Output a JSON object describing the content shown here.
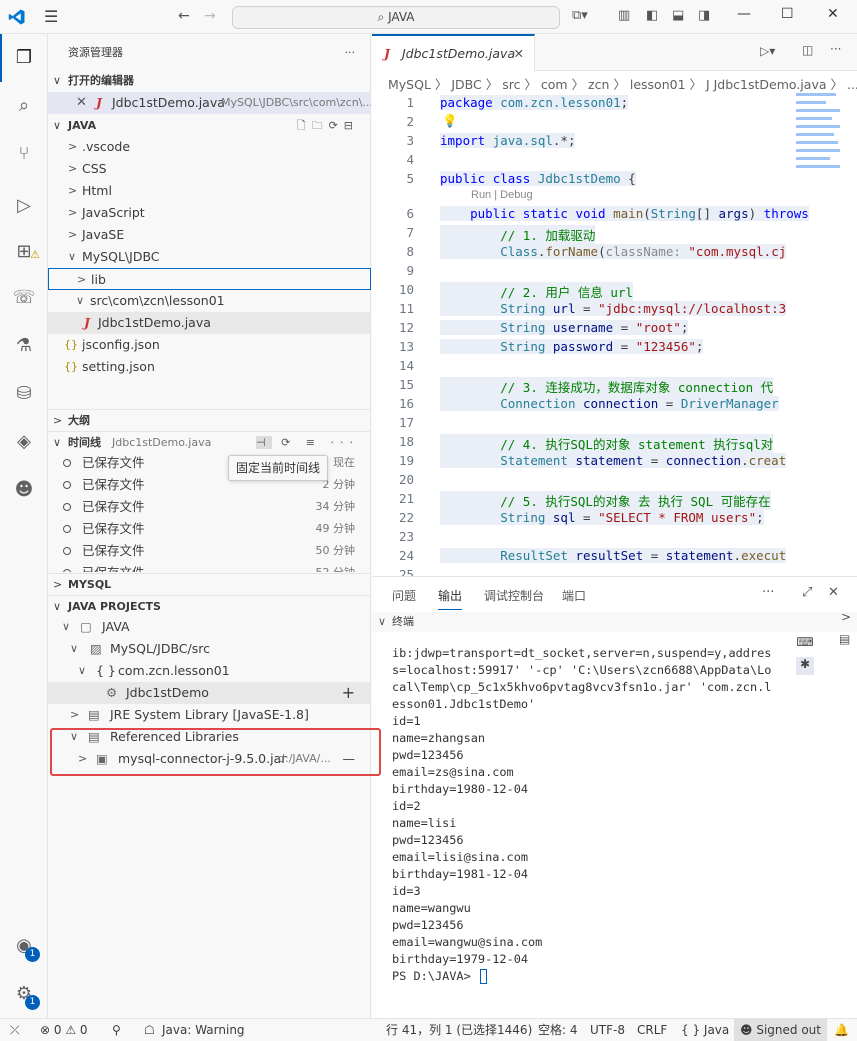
{
  "titlebar": {
    "search_text": "JAVA",
    "nav_back": "←",
    "nav_forward": "→"
  },
  "sidebar": {
    "title": "资源管理器",
    "more": "···",
    "open_editors_label": "打开的编辑器",
    "open_editor_item": {
      "name": "Jdbc1stDemo.java",
      "path": "MySQL\\JDBC\\src\\com\\zcn\\..."
    },
    "java_section_label": "JAVA",
    "tree": [
      {
        "label": ".vscode"
      },
      {
        "label": "CSS"
      },
      {
        "label": "Html"
      },
      {
        "label": "JavaScript"
      },
      {
        "label": "JavaSE"
      },
      {
        "label": "MySQL\\JDBC"
      },
      {
        "label": "lib"
      },
      {
        "label": "src\\com\\zcn\\lesson01"
      },
      {
        "label": "Jdbc1stDemo.java"
      },
      {
        "label": "jsconfig.json"
      },
      {
        "label": "setting.json"
      }
    ],
    "outline_label": "大纲",
    "timeline_label": "时间线",
    "timeline_file": "Jdbc1stDemo.java",
    "timeline_tooltip": "固定当前时间线",
    "timeline_items": [
      {
        "label": "已保存文件",
        "time": "现在"
      },
      {
        "label": "已保存文件",
        "time": "2 分钟"
      },
      {
        "label": "已保存文件",
        "time": "34 分钟"
      },
      {
        "label": "已保存文件",
        "time": "49 分钟"
      },
      {
        "label": "已保存文件",
        "time": "50 分钟"
      },
      {
        "label": "已保存文件",
        "time": "52 分钟"
      }
    ],
    "mysql_label": "MYSQL",
    "java_projects_label": "JAVA PROJECTS",
    "projects": [
      {
        "label": "JAVA"
      },
      {
        "label": "MySQL/JDBC/src"
      },
      {
        "label": "com.zcn.lesson01"
      },
      {
        "label": "Jdbc1stDemo"
      },
      {
        "label": "JRE System Library [JavaSE-1.8]"
      },
      {
        "label": "Referenced Libraries"
      },
      {
        "label": "mysql-connector-j-9.5.0.jar",
        "path": "d:/JAVA/..."
      }
    ]
  },
  "editor": {
    "tab_name": "Jdbc1stDemo.java",
    "breadcrumb": "MySQL 〉 JDBC 〉 src 〉 com 〉 zcn 〉 lesson01 〉 J  Jdbc1stDemo.java 〉 ...",
    "codelens": "Run | Debug",
    "line_numbers": [
      "1",
      "2",
      "3",
      "4",
      "5",
      "6",
      "7",
      "8",
      "9",
      "10",
      "11",
      "12",
      "13",
      "14",
      "15",
      "16",
      "17",
      "18",
      "19",
      "20",
      "21",
      "22",
      "23",
      "24",
      "25"
    ]
  },
  "panel": {
    "tabs": [
      "问题",
      "输出",
      "调试控制台",
      "端口"
    ],
    "terminal_label": "终端",
    "terminal_output": "ib:jdwp=transport=dt_socket,server=n,suspend=y,address=localhost:59917' '-cp' 'C:\\Users\\zcn6688\\AppData\\Local\\Temp\\cp_5c1x5khvo6pvtag8vcv3fsn1o.jar' 'com.zcn.lesson01.Jdbc1stDemo'\nid=1\nname=zhangsan\npwd=123456\nemail=zs@sina.com\nbirthday=1980-12-04\nid=2\nname=lisi\npwd=123456\nemail=lisi@sina.com\nbirthday=1981-12-04\nid=3\nname=wangwu\npwd=123456\nemail=wangwu@sina.com\nbirthday=1979-12-04\nPS D:\\JAVA> "
  },
  "statusbar": {
    "errors": "⊗ 0 ⚠ 0",
    "java_status": "Java: Warning",
    "position": "行 41，列 1 (已选择1446)",
    "spaces": "空格: 4",
    "encoding": "UTF-8",
    "eol": "CRLF",
    "language": "{ } Java",
    "account": "Signed out"
  },
  "activity_badges": {
    "accounts": "1",
    "manage": "1"
  },
  "colors": {
    "accent": "#005fb8",
    "highlight_box": "#e04848"
  }
}
